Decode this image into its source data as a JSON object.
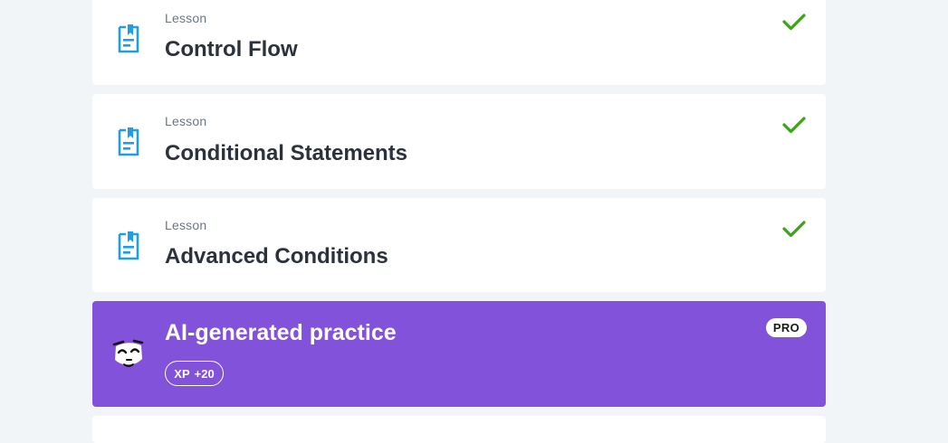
{
  "lessons": [
    {
      "kind": "Lesson",
      "title": "Control Flow",
      "icon": "lesson-bookmark-icon",
      "status": "completed"
    },
    {
      "kind": "Lesson",
      "title": "Conditional Statements",
      "icon": "lesson-bookmark-icon",
      "status": "completed"
    },
    {
      "kind": "Lesson",
      "title": "Advanced Conditions",
      "icon": "lesson-bookmark-icon",
      "status": "completed"
    }
  ],
  "practice": {
    "title": "AI-generated practice",
    "xp_label": "XP",
    "xp_value": "+20",
    "badge": "PRO",
    "icon": "ai-mascot-icon"
  },
  "colors": {
    "accent": "#1e9ee8",
    "check": "#3aa616",
    "practice_bg": "#8352db",
    "page_bg": "#f2f5f8"
  }
}
